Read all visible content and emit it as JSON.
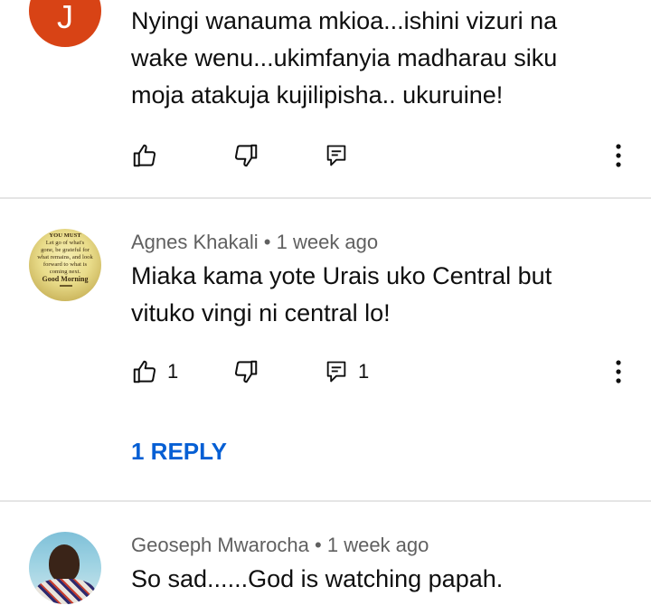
{
  "comments": [
    {
      "avatar_letter": "J",
      "avatar_color": "#d84315",
      "text": "Nyingi wanauma mkioa...ishini vizuri na wake wenu...ukimfanyia madharau siku moja atakuja kujilipisha..  ukuruine!",
      "line1": "Nyingi wanauma mkioa...ishini vizuri na",
      "line2": "wake wenu...ukimfanyia madharau siku",
      "line3": "moja atakuja kujilipisha..  ukuruine!"
    },
    {
      "author": "Agnes Khakali",
      "time": "1 week ago",
      "line1": "Miaka kama yote Urais uko Central but",
      "line2": "vituko vingi ni central lo!",
      "like_count": "1",
      "reply_count": "1",
      "replies_link": "1 REPLY",
      "avatar_text": {
        "l1": "YOU MUST",
        "l2": "Let go of what's",
        "l3": "gone, be grateful for",
        "l4": "what remains, and look",
        "l5": "forward to what is",
        "l6": "coming next.",
        "l7": "Good Morning"
      }
    },
    {
      "author": "Geoseph Mwarocha",
      "time": "1 week ago",
      "line1": "So sad......God is watching papah."
    }
  ],
  "separator": "•",
  "colors": {
    "link": "#065fd4",
    "meta": "#606060",
    "divider": "#e5e5e5"
  },
  "icons": [
    "like-icon",
    "dislike-icon",
    "reply-icon",
    "more-vert-icon"
  ]
}
